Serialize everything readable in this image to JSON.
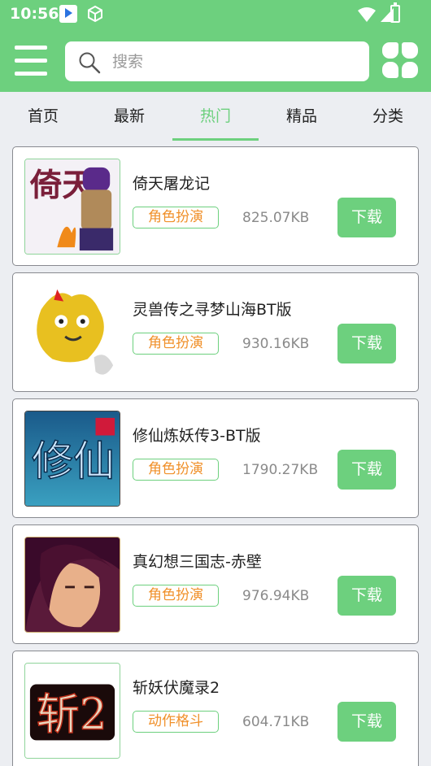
{
  "status_bar": {
    "time": "10:56",
    "icons": [
      "app-notification-icon",
      "package-icon",
      "wifi-icon",
      "signal-icon",
      "battery-icon"
    ]
  },
  "header": {
    "menu_icon": "hamburger-menu-icon",
    "search": {
      "placeholder": "搜索",
      "value": "",
      "icon": "search-icon"
    },
    "grid_icon": "clover-grid-icon",
    "background_color": "#6dd07e"
  },
  "tabs": {
    "items": [
      {
        "label": "首页"
      },
      {
        "label": "最新"
      },
      {
        "label": "热门"
      },
      {
        "label": "精品"
      },
      {
        "label": "分类"
      }
    ],
    "active": "热门",
    "active_color": "#6dd07e"
  },
  "games": [
    {
      "title": "倚天屠龙记",
      "category": "角色扮演",
      "size": "825.07KB",
      "download_label": "下载",
      "thumb_text": "倚天"
    },
    {
      "title": "灵兽传之寻梦山海BT版",
      "category": "角色扮演",
      "size": "930.16KB",
      "download_label": "下载",
      "thumb_text": ""
    },
    {
      "title": "修仙炼妖传3-BT版",
      "category": "角色扮演",
      "size": "1790.27KB",
      "download_label": "下载",
      "thumb_text": "修仙"
    },
    {
      "title": "真幻想三国志-赤壁",
      "category": "角色扮演",
      "size": "976.94KB",
      "download_label": "下载",
      "thumb_text": ""
    },
    {
      "title": "斩妖伏魔录2",
      "category": "动作格斗",
      "size": "604.71KB",
      "download_label": "下载",
      "thumb_text": "斩2"
    }
  ],
  "colors": {
    "accent": "#6dd07e",
    "tag_text": "#f0902a",
    "page_bg": "#eceef2"
  }
}
